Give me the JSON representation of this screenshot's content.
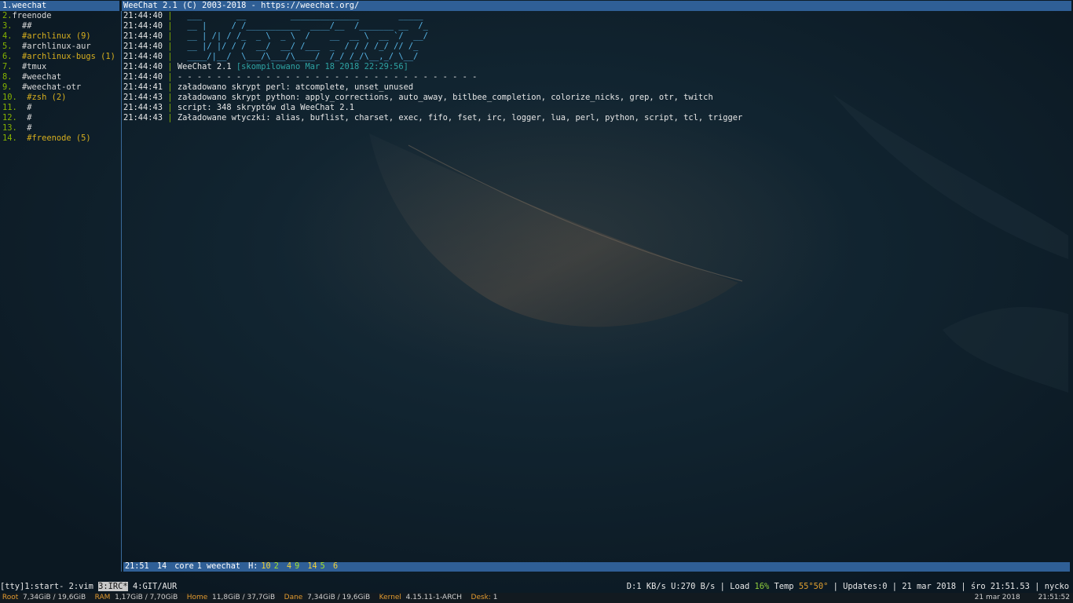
{
  "window_title": "WeeChat 2.1 (C) 2003-2018 - https://weechat.org/",
  "buflist": [
    {
      "num": "1.",
      "name": "weechat",
      "active": true
    },
    {
      "num": "2.",
      "name": "freenode"
    },
    {
      "num": "3.",
      "name": "##"
    },
    {
      "num": "4.",
      "name": "#archlinux",
      "badge": "(9)",
      "hot": true
    },
    {
      "num": "5.",
      "name": "#archlinux-aur"
    },
    {
      "num": "6.",
      "name": "#archlinux-bugs",
      "badge": "(1)",
      "hot": true
    },
    {
      "num": "7.",
      "name": "#tmux"
    },
    {
      "num": "8.",
      "name": "#weechat"
    },
    {
      "num": "9.",
      "name": "#weechat-otr"
    },
    {
      "num": "10.",
      "name": "#zsh",
      "badge": "(2)",
      "hot": true
    },
    {
      "num": "11.",
      "name": "#"
    },
    {
      "num": "12.",
      "name": "#"
    },
    {
      "num": "13.",
      "name": "#"
    },
    {
      "num": "14.",
      "name": "#freenode",
      "badge": "(5)",
      "hot": true
    }
  ],
  "logo_lines": [
    "  ___       __         ______________        _____",
    "  __ |     / /___________  ____/__  /_______ __  /_",
    "  __ | /| / /_  _ \\  _ \\  /    __  __ \\  __ `/  __/",
    "  __ |/ |/ / /  __/  __/ /___  _  / / / /_/ // /_",
    "  ____/|__/  \\___/\\___/\\____/  /_/ /_/\\__,_/ \\__/"
  ],
  "chat": {
    "logo_times": [
      "21:44:40",
      "21:44:40",
      "21:44:40",
      "21:44:40",
      "21:44:40"
    ],
    "version_time": "21:44:40",
    "version_text": "WeeChat 2.1",
    "compiled_text": "[skompilowano Mar 18 2018 22:29:56]",
    "dashes_time": "21:44:40",
    "dashes": "- - - - - - - - - - - - - - - - - - - - - - - - - - - - - - -",
    "messages": [
      {
        "time": "21:44:41",
        "text": "załadowano skrypt perl: atcomplete, unset_unused"
      },
      {
        "time": "21:44:43",
        "text": "załadowano skrypt python: apply_corrections, auto_away, bitlbee_completion, colorize_nicks, grep, otr, twitch"
      },
      {
        "time": "21:44:43",
        "text": "script: 348 skryptów dla WeeChat 2.1"
      },
      {
        "time": "21:44:43",
        "text": "Załadowane wtyczki: alias, buflist, charset, exec, fifo, fset, irc, logger, lua, perl, python, script, tcl, trigger"
      }
    ]
  },
  "statusbar": {
    "time": "21:51",
    "buffer_number": "14",
    "core": "core",
    "buffer": "1 weechat",
    "hotlist_label": "H:",
    "h1": "10",
    "h1c": "2",
    "h2": "4",
    "h2c": "9",
    "h3": "14",
    "h3c": "5",
    "h4": "6"
  },
  "tmux": {
    "session": "[tty]",
    "windows": [
      "1:start-",
      "2:vim",
      "3:IRC*",
      "4:GIT/AUR"
    ],
    "net": "D:1 KB/s U:270 B/s",
    "load_label": "Load",
    "load_value": "16%",
    "temp_label": "Temp",
    "temp_value": "55°50°",
    "updates": "Updates:0",
    "date": "21 mar 2018",
    "day_time": "śro 21:51.53",
    "user": "nycko"
  },
  "sysbar": {
    "root_label": "Root",
    "root_value": "7,34GiB / 19,6GiB",
    "ram_label": "RAM",
    "ram_value": "1,17GiB / 7,70GiB",
    "home_label": "Home",
    "home_value": "11,8GiB / 37,7GiB",
    "dane_label": "Dane",
    "dane_value": "7,34GiB / 19,6GiB",
    "kernel_label": "Kernel",
    "kernel_value": "4.15.11-1-ARCH",
    "desk_label": "Desk:",
    "desk_value": "1",
    "date": "21 mar 2018",
    "clock": "21:51:52"
  },
  "colors": {
    "accent_bar": "#2f5f96",
    "number_green": "#86b300",
    "hot_yellow": "#d7af1e",
    "logo_blue": "#58b6e8",
    "compiled_teal": "#2ea3a3",
    "label_orange": "#e29a2f"
  }
}
